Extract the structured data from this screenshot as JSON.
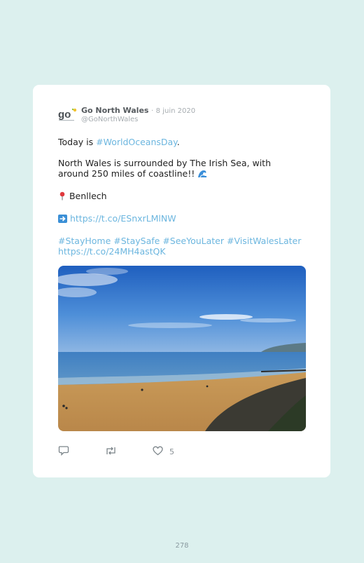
{
  "tweet": {
    "author_name": "Go North Wales",
    "separator": "·",
    "date": "8 juin 2020",
    "handle": "@GoNorthWales",
    "line1_prefix": "Today is ",
    "line1_hashtag": "#WorldOceansDay",
    "line1_suffix": ".",
    "line2": "North Wales is surrounded by The Irish Sea, with around 250 miles of coastline!!",
    "location": "Benllech",
    "link1": "https://t.co/ESnxrLMlNW",
    "hashtags": [
      "#StayHome",
      "#StaySafe",
      "#SeeYouLater",
      "#VisitWalesLater"
    ],
    "link2": "https://t.co/24MH4astQK",
    "like_count": "5"
  },
  "icons": {
    "logo": "go-north-wales-logo",
    "wave": "water-wave-icon",
    "pin": "round-pushpin-icon",
    "arrow": "right-arrow-icon",
    "reply": "reply-icon",
    "retweet": "retweet-icon",
    "like": "heart-icon"
  },
  "colors": {
    "link": "#6cb6df",
    "background": "#dcf0ee"
  },
  "page_number": "278"
}
